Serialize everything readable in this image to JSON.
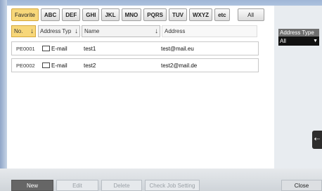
{
  "tabs": [
    {
      "label": "Favorite",
      "active": true
    },
    {
      "label": "ABC"
    },
    {
      "label": "DEF"
    },
    {
      "label": "GHI"
    },
    {
      "label": "JKL"
    },
    {
      "label": "MNO"
    },
    {
      "label": "PQRS"
    },
    {
      "label": "TUV"
    },
    {
      "label": "WXYZ"
    },
    {
      "label": "etc"
    },
    {
      "label": "All"
    }
  ],
  "columns": {
    "no": "No.",
    "type": "Address Typ",
    "name": "Name",
    "address": "Address"
  },
  "rows": [
    {
      "no": "PE0001",
      "type": "E-mail",
      "name": "test1",
      "address": "test@mail.eu"
    },
    {
      "no": "PE0002",
      "type": "E-mail",
      "name": "test2",
      "address": "test2@mail.de"
    }
  ],
  "address_type": {
    "label": "Address Type",
    "value": "All"
  },
  "buttons": {
    "new": "New",
    "edit": "Edit",
    "delete": "Delete",
    "check_job_setting": "Check Job Setting",
    "close": "Close"
  },
  "colors": {
    "active_tab": "#f7d77a",
    "header_bar": "#9fb6d6"
  }
}
